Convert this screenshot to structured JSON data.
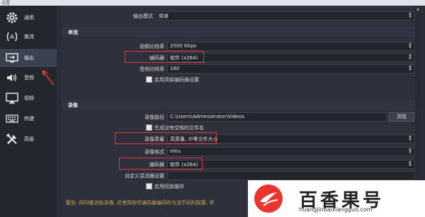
{
  "window": {
    "title": "设置"
  },
  "sidebar": {
    "items": [
      {
        "label": "通用",
        "icon": "gear-icon",
        "active": false
      },
      {
        "label": "推流",
        "icon": "broadcast-icon",
        "active": false
      },
      {
        "label": "输出",
        "icon": "output-icon",
        "active": true
      },
      {
        "label": "音频",
        "icon": "speaker-icon",
        "active": false
      },
      {
        "label": "视频",
        "icon": "monitor-icon",
        "active": false
      },
      {
        "label": "热键",
        "icon": "keyboard-icon",
        "active": false
      },
      {
        "label": "高级",
        "icon": "tools-icon",
        "active": false
      }
    ]
  },
  "output_mode": {
    "label": "输出模式",
    "value": "简单"
  },
  "streaming": {
    "header": "串流",
    "video_bitrate": {
      "label": "视频比特率",
      "value": "2500 Kbps"
    },
    "encoder": {
      "label": "编码器",
      "value": "软件 (x264)"
    },
    "audio_bitrate": {
      "label": "音频比特率",
      "value": "160"
    },
    "advanced_encoder": {
      "label": "启用高级编码器设置"
    }
  },
  "recording": {
    "header": "录像",
    "path": {
      "label": "录像路径",
      "value": "C:\\Users\\Administrator\\Videos",
      "browse": "浏览"
    },
    "no_space": {
      "label": "生成没有空格的文件名"
    },
    "quality": {
      "label": "录像质量",
      "value": "高质量, 中等文件大小"
    },
    "format": {
      "label": "录像格式",
      "value": "mkv"
    },
    "encoder": {
      "label": "编码器",
      "value": "软件 (x264)"
    },
    "muxer": {
      "label": "自定义混流器设置"
    },
    "replay_buffer": {
      "label": "启用回放缓存"
    }
  },
  "warning": "警告: 同时推流和录像, 并使用软件编码器编码时与流不同的配置, 将",
  "watermark": {
    "name": "百香果号",
    "url": "huangjinbaixiangguo.com"
  },
  "colors": {
    "highlight": "#e23a3a",
    "warning": "#c9a64a",
    "sidebar_active": "#3a4250"
  }
}
